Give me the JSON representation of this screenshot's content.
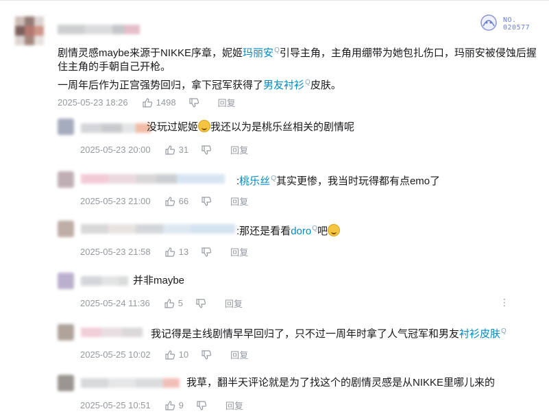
{
  "badge": {
    "line1": "NO.",
    "line2": "020577"
  },
  "main": {
    "line1_a": "剧情灵感maybe来源于NIKKE序章，妮姬",
    "line1_link": "玛丽安",
    "line1_b": "引导主角，主角用绷带为她包扎伤口，玛丽安被侵蚀后握",
    "line2": "住主角的手朝自己开枪。",
    "line3_a": "一周年后作为正宫强势回归，拿下冠军获得了",
    "line3_link": "男友衬衫",
    "line3_b": "皮肤。",
    "time": "2025-05-23 18:26",
    "likes": "1498",
    "reply": "回复"
  },
  "replies": [
    {
      "pre": "",
      "text": "没玩过妮姬",
      "emoji": true,
      "text2": "我还以为是桃乐丝相关的剧情呢",
      "link": "",
      "after": "",
      "time": "2025-05-23 20:00",
      "likes": "31",
      "reply": "回复"
    },
    {
      "pre": ":",
      "text": "",
      "link": "桃乐丝",
      "after": "其实更惨，我当时玩得都有点emo了",
      "time": "2025-05-23 21:00",
      "likes": "66",
      "reply": "回复"
    },
    {
      "pre": ":",
      "text": "那还是看看",
      "link": "doro",
      "after": "吧",
      "time": "2025-05-23 21:58",
      "likes": "13",
      "reply": "回复"
    },
    {
      "text": "并非maybe",
      "time": "2025-05-24 11:36",
      "likes": "5",
      "reply": "回复"
    },
    {
      "text": "我记得是主线剧情早早回归了，只不过一周年时拿了人气冠军和男友",
      "link": "衬衫皮肤",
      "time": "2025-05-25 10:02",
      "likes": "10",
      "reply": "回复"
    },
    {
      "text": "我草，翻半天评论就是为了找这个的剧情灵感是从NIKKE里哪儿来的",
      "time": "2025-05-25 10:51",
      "likes": "9",
      "reply": "回复"
    }
  ],
  "search_mark": "Q",
  "more_icon": "⋮",
  "colors": {
    "link": "#008ac5",
    "meta": "#9499a0",
    "text": "#18191c"
  }
}
